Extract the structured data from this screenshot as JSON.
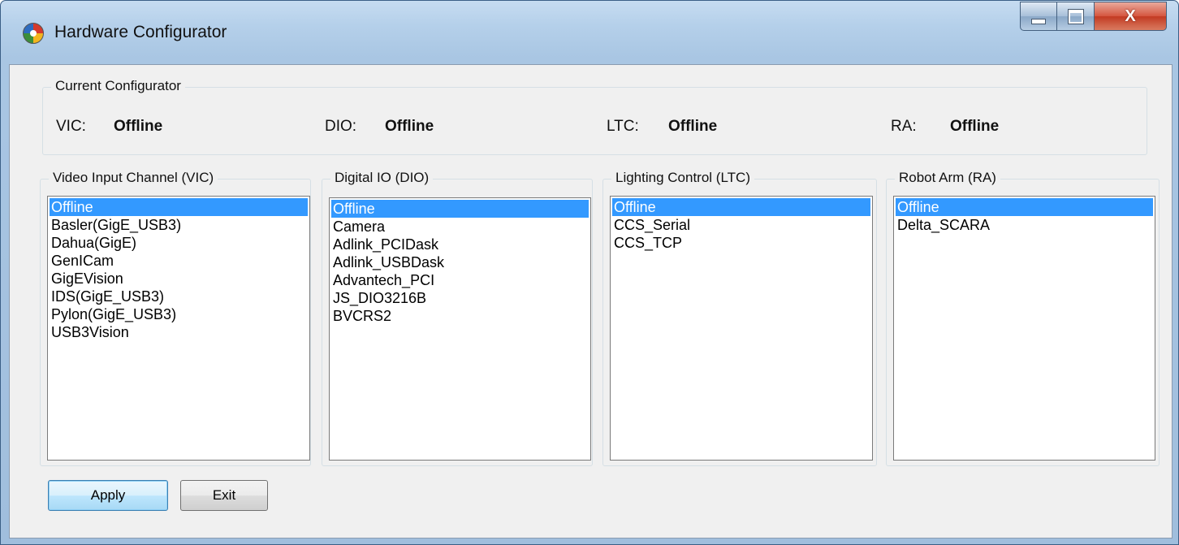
{
  "window": {
    "title": "Hardware Configurator",
    "app_icon": "configurator-icon",
    "close_glyph": "X"
  },
  "current": {
    "title": "Current Configurator",
    "items": [
      {
        "label": "VIC:",
        "value": "Offline"
      },
      {
        "label": "DIO:",
        "value": "Offline"
      },
      {
        "label": "LTC:",
        "value": "Offline"
      },
      {
        "label": "RA:",
        "value": "Offline"
      }
    ]
  },
  "groups": [
    {
      "title": "Video Input Channel (VIC)",
      "selected": 0,
      "items": [
        "Offline",
        "Basler(GigE_USB3)",
        "Dahua(GigE)",
        "GenICam",
        "GigEVision",
        "IDS(GigE_USB3)",
        "Pylon(GigE_USB3)",
        "USB3Vision"
      ]
    },
    {
      "title": "Digital IO (DIO)",
      "selected": 0,
      "items": [
        "Offline",
        "Camera",
        "Adlink_PCIDask",
        "Adlink_USBDask",
        "Advantech_PCI",
        "JS_DIO3216B",
        "BVCRS2"
      ]
    },
    {
      "title": "Lighting Control (LTC)",
      "selected": 0,
      "items": [
        "Offline",
        "CCS_Serial",
        "CCS_TCP"
      ]
    },
    {
      "title": "Robot Arm (RA)",
      "selected": 0,
      "items": [
        "Offline",
        "Delta_SCARA"
      ]
    }
  ],
  "buttons": {
    "apply": "Apply",
    "exit": "Exit"
  },
  "colors": {
    "selection": "#3399ff",
    "frame": "#a9c6e3",
    "close": "#c23a22"
  }
}
